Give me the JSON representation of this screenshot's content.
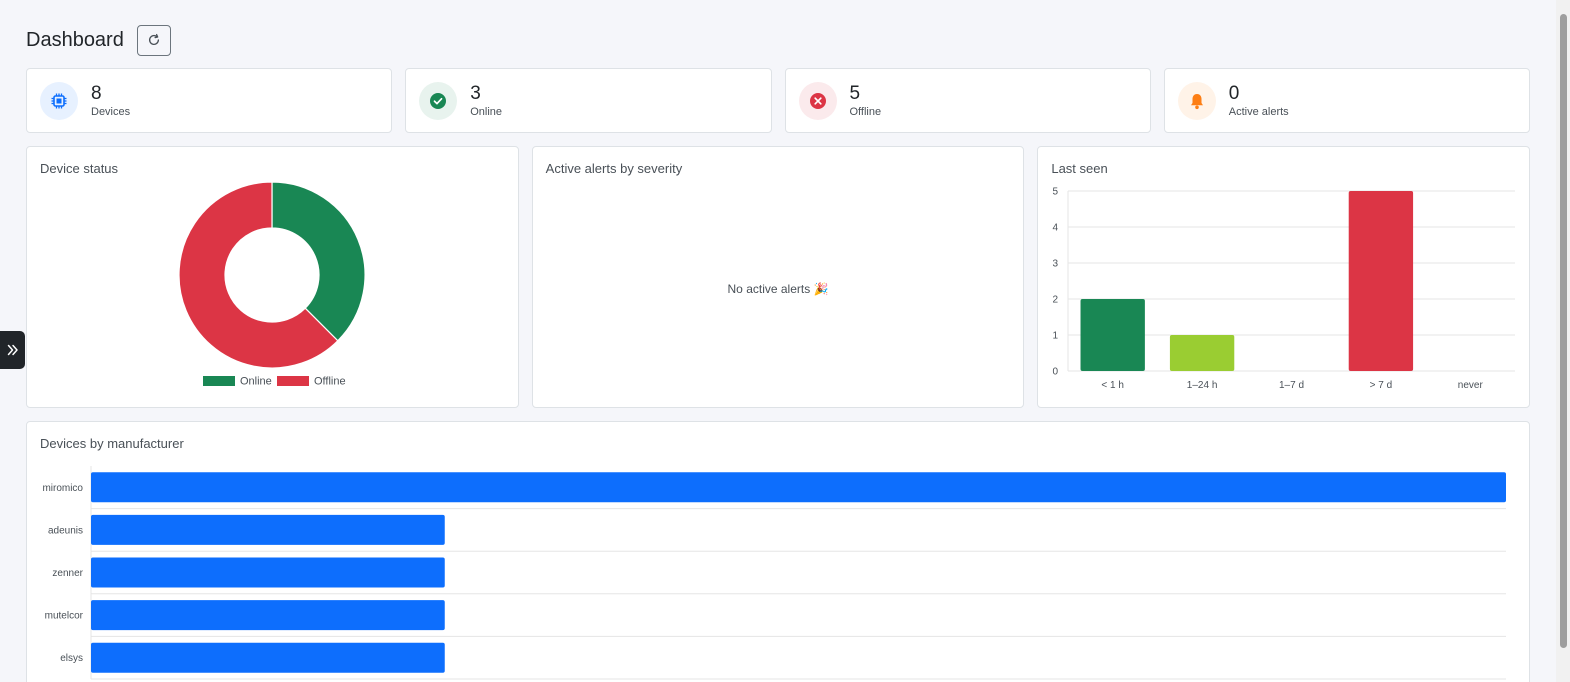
{
  "header": {
    "title": "Dashboard",
    "refresh_icon": "refresh-icon"
  },
  "stats": [
    {
      "value": "8",
      "label": "Devices",
      "icon": "chip-icon",
      "color": "#0d6efd",
      "bg": "#e7f1ff"
    },
    {
      "value": "3",
      "label": "Online",
      "icon": "check-circle-icon",
      "color": "#198754",
      "bg": "#e8f3ee"
    },
    {
      "value": "5",
      "label": "Offline",
      "icon": "x-circle-icon",
      "color": "#dc3545",
      "bg": "#fbeaec"
    },
    {
      "value": "0",
      "label": "Active alerts",
      "icon": "bell-icon",
      "color": "#fd7e14",
      "bg": "#fff3e8"
    }
  ],
  "panels": {
    "device_status": {
      "title": "Device status"
    },
    "alerts": {
      "title": "Active alerts by severity",
      "empty_message": "No active alerts 🎉"
    },
    "last_seen": {
      "title": "Last seen"
    },
    "manufacturer": {
      "title": "Devices by manufacturer"
    }
  },
  "chart_data": [
    {
      "type": "pie",
      "categories": [
        "Online",
        "Offline"
      ],
      "values": [
        3,
        5
      ],
      "colors": [
        "#198754",
        "#dc3545"
      ],
      "legend": "bottom"
    },
    {
      "type": "bar",
      "categories": [
        "< 1 h",
        "1–24 h",
        "1–7 d",
        "> 7 d",
        "never"
      ],
      "values": [
        2,
        1,
        0,
        5,
        0
      ],
      "colors": [
        "#198754",
        "#9acd32",
        "#fd7e14",
        "#dc3545",
        "#6c757d"
      ],
      "ylim": [
        0,
        5
      ],
      "yticks": [
        "0",
        "1",
        "2",
        "3",
        "4",
        "5"
      ],
      "grid": true
    },
    {
      "type": "bar",
      "orientation": "horizontal",
      "categories": [
        "miromico",
        "adeunis",
        "zenner",
        "mutelcor",
        "elsys"
      ],
      "values": [
        4,
        1,
        1,
        1,
        1
      ],
      "color": "#0d6efd",
      "xlim": [
        0,
        4
      ],
      "grid": true
    }
  ]
}
